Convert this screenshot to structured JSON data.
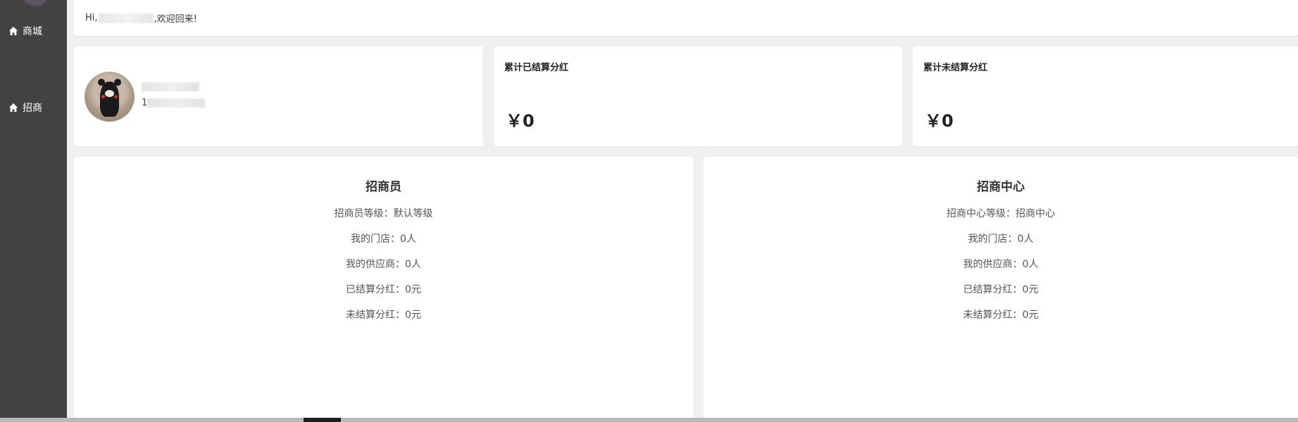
{
  "sidebar": {
    "items": [
      {
        "label": "商城",
        "icon": "home-icon"
      },
      {
        "label": "招商",
        "icon": "home-icon"
      }
    ]
  },
  "header": {
    "greeting_prefix": "Hi,",
    "greeting_suffix": ",欢迎回来!"
  },
  "user_card": {
    "name_prefix": "",
    "phone_prefix": "1"
  },
  "stats": {
    "settled": {
      "title": "累计已结算分红",
      "value": "￥0"
    },
    "unsettled": {
      "title": "累计未结算分红",
      "value": "￥0"
    }
  },
  "panels": {
    "recruiter": {
      "title": "招商员",
      "level": "招商员等级：默认等级",
      "stores": "我的门店：0人",
      "suppliers": "我的供应商：0人",
      "settled": "已结算分红：0元",
      "unsettled": "未结算分红：0元"
    },
    "center": {
      "title": "招商中心",
      "level": "招商中心等级：招商中心",
      "stores": "我的门店：0人",
      "suppliers": "我的供应商：0人",
      "settled": "已结算分红：0元",
      "unsettled": "未结算分红：0元"
    }
  },
  "colors": {
    "sidebar_bg": "#424242",
    "page_bg": "#eef0f2",
    "card_bg": "#ffffff"
  }
}
